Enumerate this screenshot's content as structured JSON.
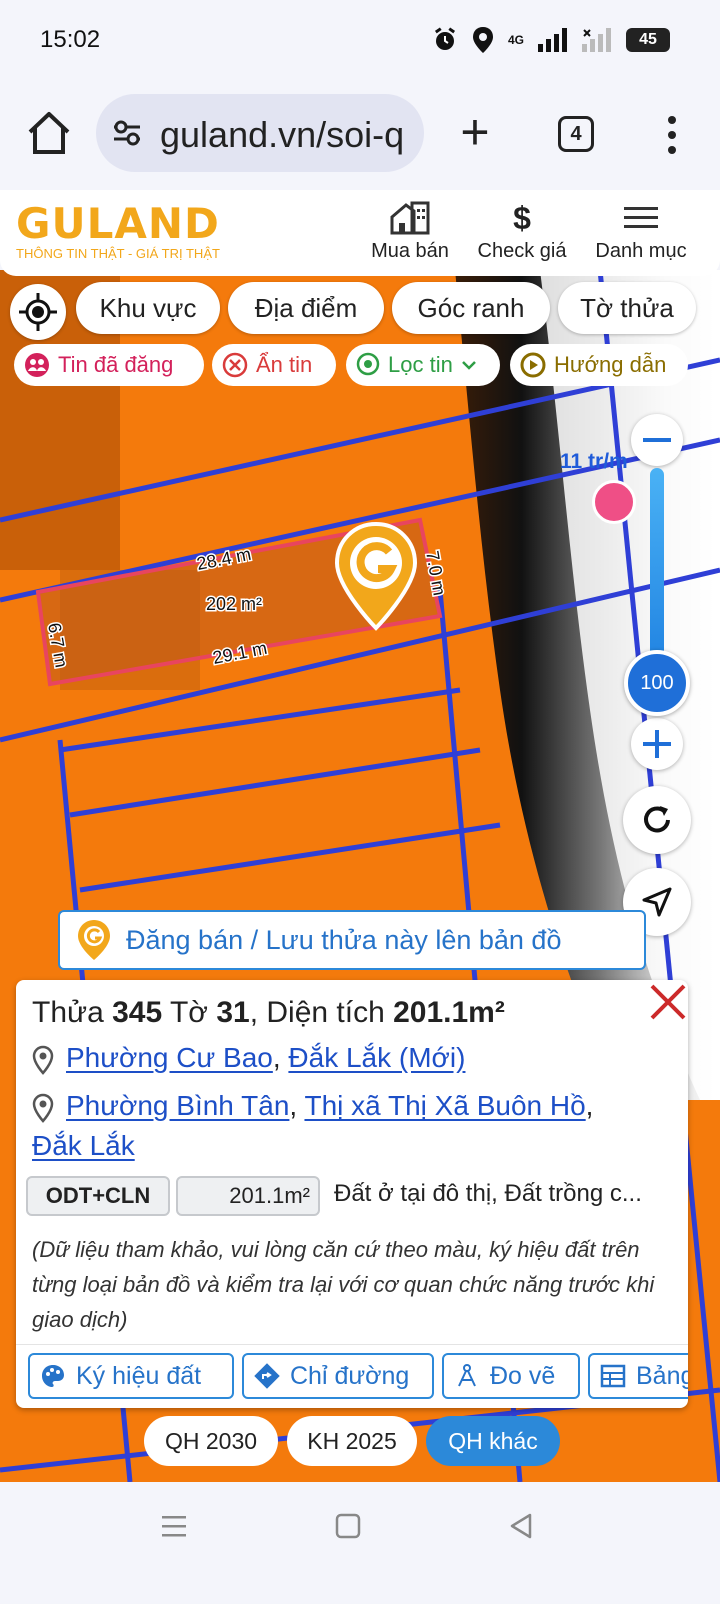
{
  "status": {
    "time": "15:02",
    "network": "4G",
    "battery": "45"
  },
  "browser": {
    "url": "guland.vn/soi-q",
    "tab_count": "4"
  },
  "site": {
    "logo": "GULAND",
    "tagline": "THÔNG TIN THẬT - GIÁ TRỊ THẬT",
    "nav": [
      {
        "label": "Mua bán",
        "icon": "building-icon"
      },
      {
        "label": "Check giá",
        "icon": "dollar-icon"
      },
      {
        "label": "Danh mục",
        "icon": "hamburger-icon"
      }
    ]
  },
  "map_tools": {
    "chips": [
      "Khu vực",
      "Địa điểm",
      "Góc ranh",
      "Tờ thửa"
    ],
    "filters": [
      {
        "label": "Tin đã đăng",
        "color": "#d3215b"
      },
      {
        "label": "Ẩn tin",
        "color": "#d93b3b"
      },
      {
        "label": "Lọc tin",
        "color": "#2e9e45"
      },
      {
        "label": "Hướng dẫn",
        "color": "#8a6d00"
      }
    ],
    "price_label": "11 tr/m",
    "zoom_value": "100"
  },
  "parcel": {
    "top_edge": "28.4 m",
    "bottom_edge": "29.1 m",
    "left_edge": "6.7 m",
    "right_edge": "7.0 m",
    "area": "202 m²"
  },
  "post_banner": "Đăng bán / Lưu thửa này lên bản đồ",
  "info": {
    "title_prefix": "Thửa",
    "lot": "345",
    "sheet_prefix": "Tờ",
    "sheet": "31",
    "area_prefix": ", Diện tích",
    "area": "201.1m²",
    "addr_new": {
      "ward": "Phường Cư Bao",
      "sep": ",",
      "province": "Đắk Lắk (Mới)"
    },
    "addr_old": {
      "ward": "Phường Bình Tân",
      "sep1": ",",
      "town": "Thị xã Thị Xã Buôn Hồ",
      "sep2": ",",
      "province": "Đắk Lắk"
    },
    "land_code": "ODT+CLN",
    "land_area": "201.1m²",
    "land_type": "Đất ở tại đô thị, Đất trồng c...",
    "note": "(Dữ liệu tham khảo, vui lòng căn cứ theo màu, ký hiệu đất trên từng loại bản đồ và kiểm tra lại với cơ quan chức năng trước khi giao dịch)",
    "actions": [
      "Ký hiệu đất",
      "Chỉ đường",
      "Đo vẽ",
      "Bảng"
    ]
  },
  "plans": [
    "QH 2030",
    "KH 2025",
    "QH khác"
  ],
  "colors": {
    "brand": "#f2a71b",
    "accent": "#2c89d9",
    "map_orange": "#f47a0c",
    "parcel_outline": "#e8455f"
  }
}
